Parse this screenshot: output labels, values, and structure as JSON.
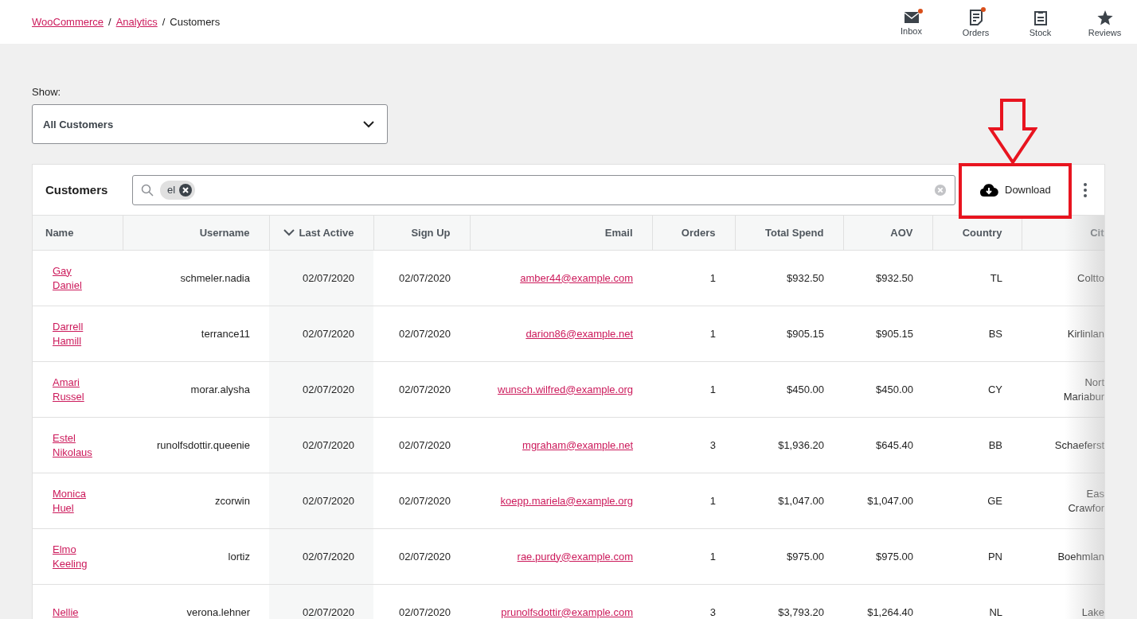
{
  "breadcrumbs": [
    {
      "label": "WooCommerce",
      "link": true
    },
    {
      "separator": "/",
      "label": "Analytics",
      "link": true
    },
    {
      "separator": "/",
      "label": "Customers",
      "link": false
    }
  ],
  "activity": [
    {
      "label": "Inbox",
      "kind": "inbox",
      "unread": true
    },
    {
      "label": "Orders",
      "kind": "orders",
      "unread": true
    },
    {
      "label": "Stock",
      "kind": "stock",
      "unread": false
    },
    {
      "label": "Reviews",
      "kind": "reviews",
      "unread": false
    }
  ],
  "filter": {
    "label": "Show:",
    "value": "All Customers"
  },
  "card": {
    "title": "Customers",
    "search_chips": [
      "el"
    ],
    "download": "Download"
  },
  "table": {
    "columns": [
      {
        "label": "Name",
        "sorted": false
      },
      {
        "label": "Username",
        "sorted": false
      },
      {
        "label": "Last Active",
        "sorted": true
      },
      {
        "label": "Sign Up",
        "sorted": false
      },
      {
        "label": "Email",
        "sorted": false
      },
      {
        "label": "Orders",
        "sorted": false
      },
      {
        "label": "Total Spend",
        "sorted": false
      },
      {
        "label": "AOV",
        "sorted": false
      },
      {
        "label": "Country",
        "sorted": false
      },
      {
        "label": "Cit",
        "sorted": false
      }
    ],
    "rows": [
      {
        "name": "Gay Daniel",
        "username": "schmeler.nadia",
        "last_active": "02/07/2020",
        "sign_up": "02/07/2020",
        "email": "amber44@example.com",
        "orders": "1",
        "total_spend": "$932.50",
        "aov": "$932.50",
        "country": "TL",
        "city": [
          "Coltto"
        ]
      },
      {
        "name": "Darrell Hamill",
        "username": "terrance11",
        "last_active": "02/07/2020",
        "sign_up": "02/07/2020",
        "email": "darion86@example.net",
        "orders": "1",
        "total_spend": "$905.15",
        "aov": "$905.15",
        "country": "BS",
        "city": [
          "Kirlinlan"
        ]
      },
      {
        "name": "Amari Russel",
        "username": "morar.alysha",
        "last_active": "02/07/2020",
        "sign_up": "02/07/2020",
        "email": "wunsch.wilfred@example.org",
        "orders": "1",
        "total_spend": "$450.00",
        "aov": "$450.00",
        "country": "CY",
        "city": [
          "Nort",
          "Mariabur"
        ]
      },
      {
        "name": "Estel Nikolaus",
        "username": "runolfsdottir.queenie",
        "last_active": "02/07/2020",
        "sign_up": "02/07/2020",
        "email": "mgraham@example.net",
        "orders": "3",
        "total_spend": "$1,936.20",
        "aov": "$645.40",
        "country": "BB",
        "city": [
          "Schaeferst"
        ]
      },
      {
        "name": "Monica Huel",
        "username": "zcorwin",
        "last_active": "02/07/2020",
        "sign_up": "02/07/2020",
        "email": "koepp.mariela@example.org",
        "orders": "1",
        "total_spend": "$1,047.00",
        "aov": "$1,047.00",
        "country": "GE",
        "city": [
          "Eas",
          "Crawfor"
        ]
      },
      {
        "name": "Elmo Keeling",
        "username": "lortiz",
        "last_active": "02/07/2020",
        "sign_up": "02/07/2020",
        "email": "rae.purdy@example.com",
        "orders": "1",
        "total_spend": "$975.00",
        "aov": "$975.00",
        "country": "PN",
        "city": [
          "Boehmlan"
        ]
      },
      {
        "name": "Nellie",
        "username": "verona.lehner",
        "last_active": "02/07/2020",
        "sign_up": "02/07/2020",
        "email": "prunolfsdottir@example.com",
        "orders": "3",
        "total_spend": "$3,793.20",
        "aov": "$1,264.40",
        "country": "NL",
        "city": [
          "Lake"
        ]
      }
    ]
  }
}
